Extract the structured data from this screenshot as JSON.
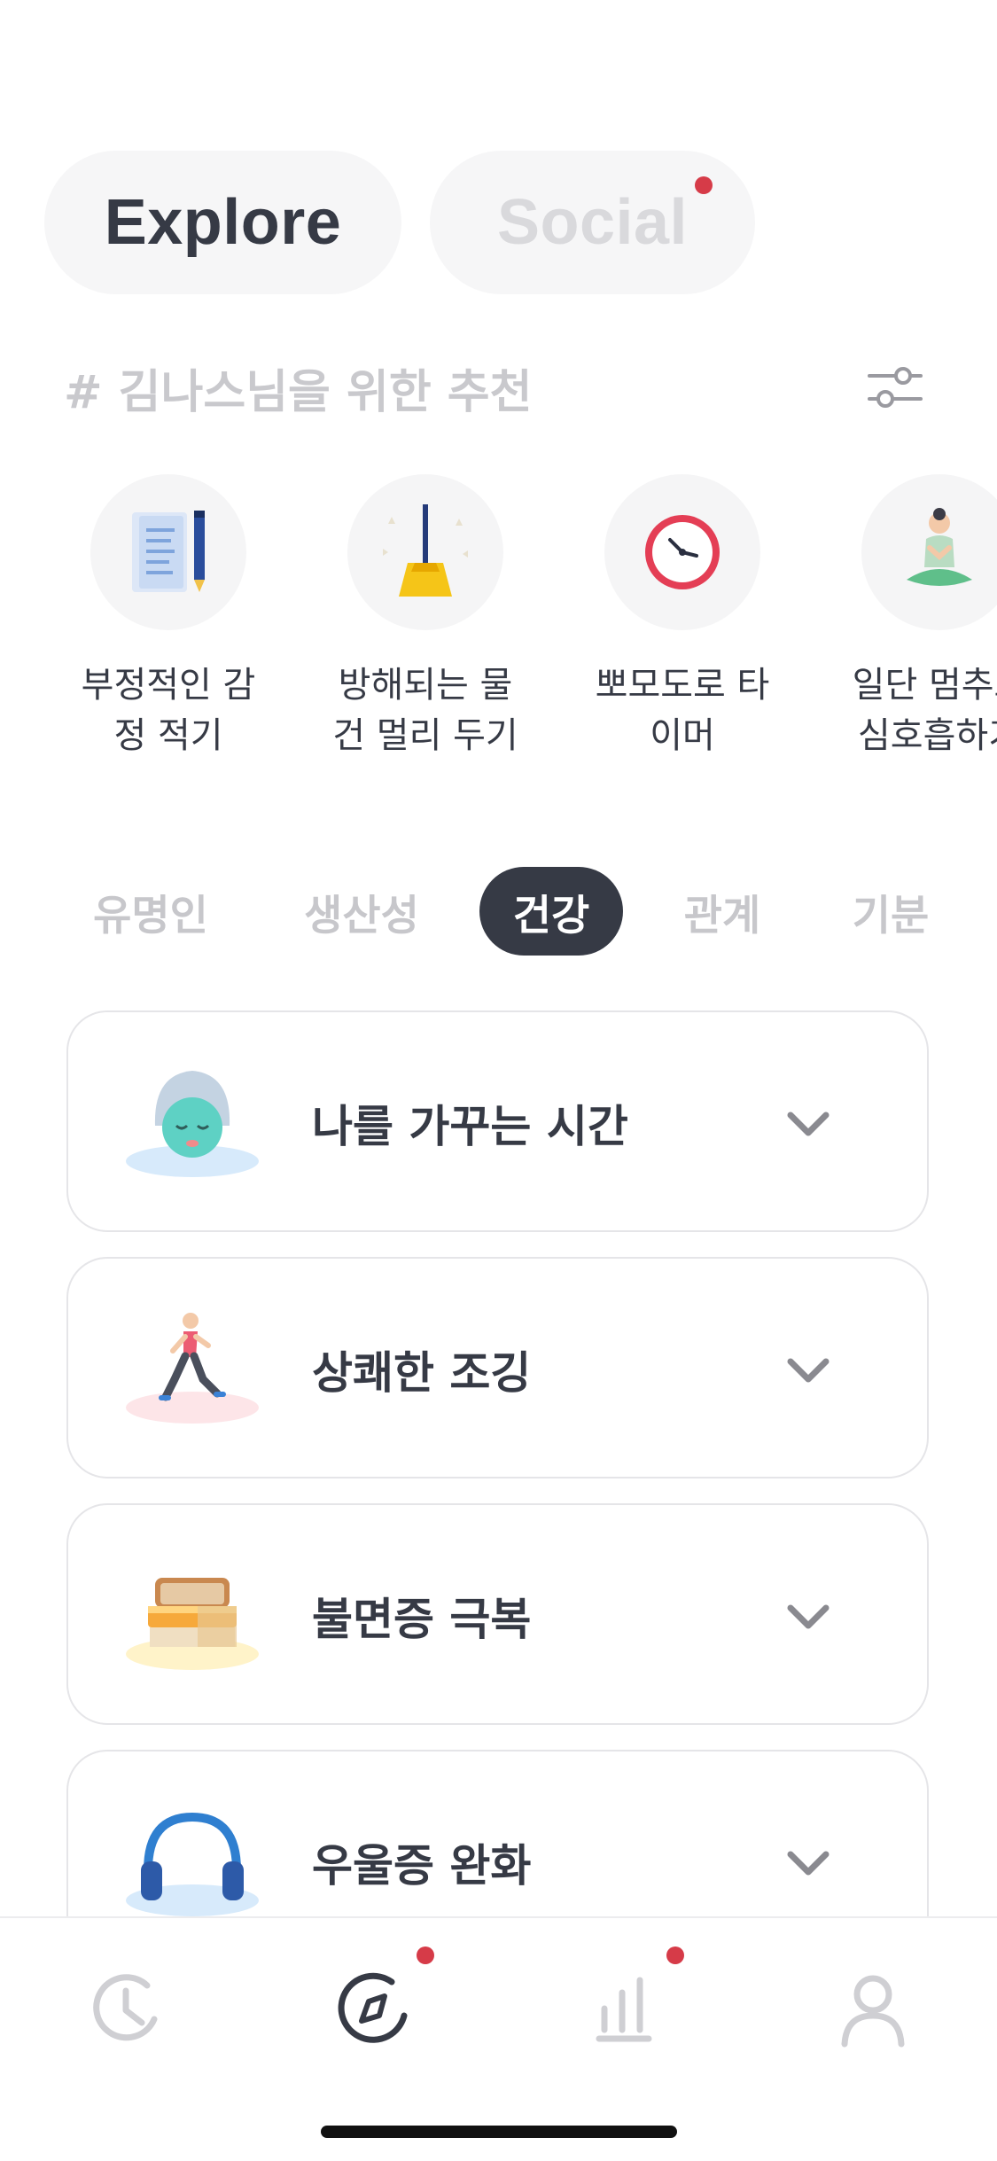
{
  "top_tabs": {
    "explore_label": "Explore",
    "social_label": "Social"
  },
  "recommendations": {
    "title": "# 김나스님을 위한 추천",
    "items": [
      {
        "label": "부정적인 감\n정 적기",
        "icon": "note-pencil-icon"
      },
      {
        "label": "방해되는 물\n건 멀리 두기",
        "icon": "broom-icon"
      },
      {
        "label": "뽀모도로 타\n이머",
        "icon": "clock-icon"
      },
      {
        "label": "일단 멈추고\n심호흡하기",
        "icon": "meditation-icon"
      }
    ]
  },
  "categories": {
    "items": [
      "유명인",
      "생산성",
      "건강",
      "관계",
      "기분"
    ],
    "active": "건강"
  },
  "programs": [
    {
      "title": "나를 가꾸는 시간",
      "icon": "face-mask-icon"
    },
    {
      "title": "상쾌한 조깅",
      "icon": "jogging-icon"
    },
    {
      "title": "불면증 극복",
      "icon": "bed-icon"
    },
    {
      "title": "우울증 완화",
      "icon": "headphones-icon"
    }
  ],
  "bottom_nav": {
    "items": [
      "clock-icon",
      "compass-icon",
      "stats-icon",
      "profile-icon"
    ],
    "active": "compass-icon"
  },
  "colors": {
    "primary_dark": "#363a45",
    "notification": "#d63b48",
    "muted": "#c7c7cb"
  }
}
